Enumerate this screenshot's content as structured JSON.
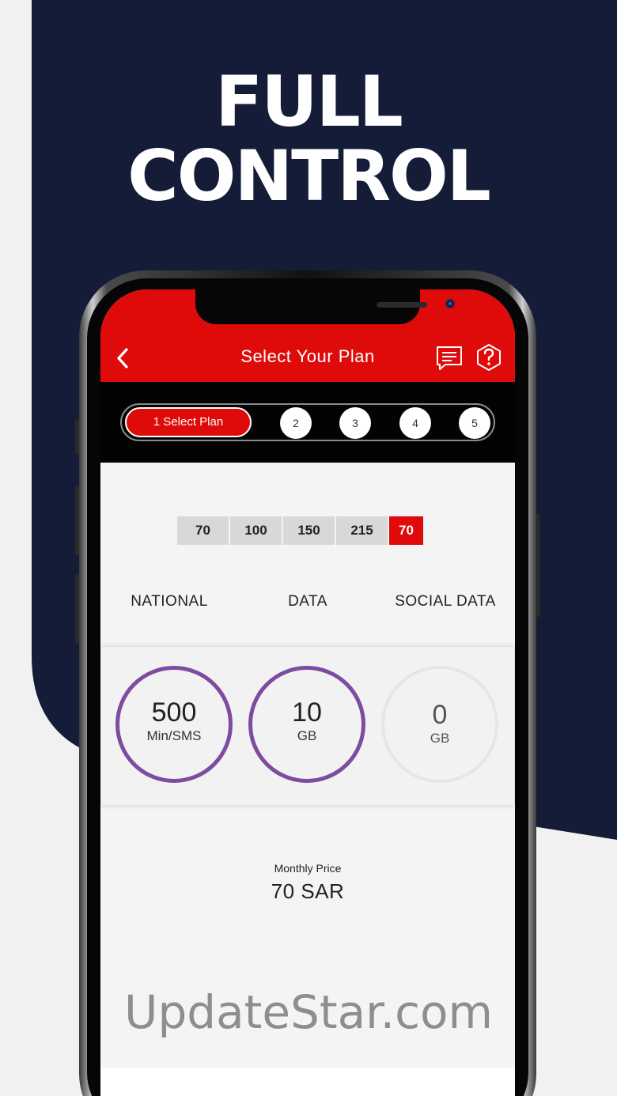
{
  "headline": {
    "line1": "FULL",
    "line2": "CONTROL"
  },
  "appbar": {
    "title": "Select Your Plan",
    "back_icon": "chevron-left-icon",
    "chat_icon": "chat-icon",
    "help_icon": "help-hexagon-icon"
  },
  "steps": {
    "active_label": "1 Select Plan",
    "others": [
      "2",
      "3",
      "4",
      "5"
    ]
  },
  "plan_tabs": [
    "70",
    "100",
    "150",
    "215",
    "70"
  ],
  "selected_tab_index": 4,
  "columns": [
    "NATIONAL",
    "DATA",
    "SOCIAL DATA"
  ],
  "stats": [
    {
      "value": "500",
      "unit": "Min/SMS"
    },
    {
      "value": "10",
      "unit": "GB"
    },
    {
      "value": "0",
      "unit": "GB"
    }
  ],
  "price": {
    "label": "Monthly Price",
    "value": "70 SAR"
  },
  "watermark": "UpdateStar.com",
  "colors": {
    "navy": "#141c38",
    "red": "#df0a0a",
    "purple": "#7d4b9f"
  }
}
